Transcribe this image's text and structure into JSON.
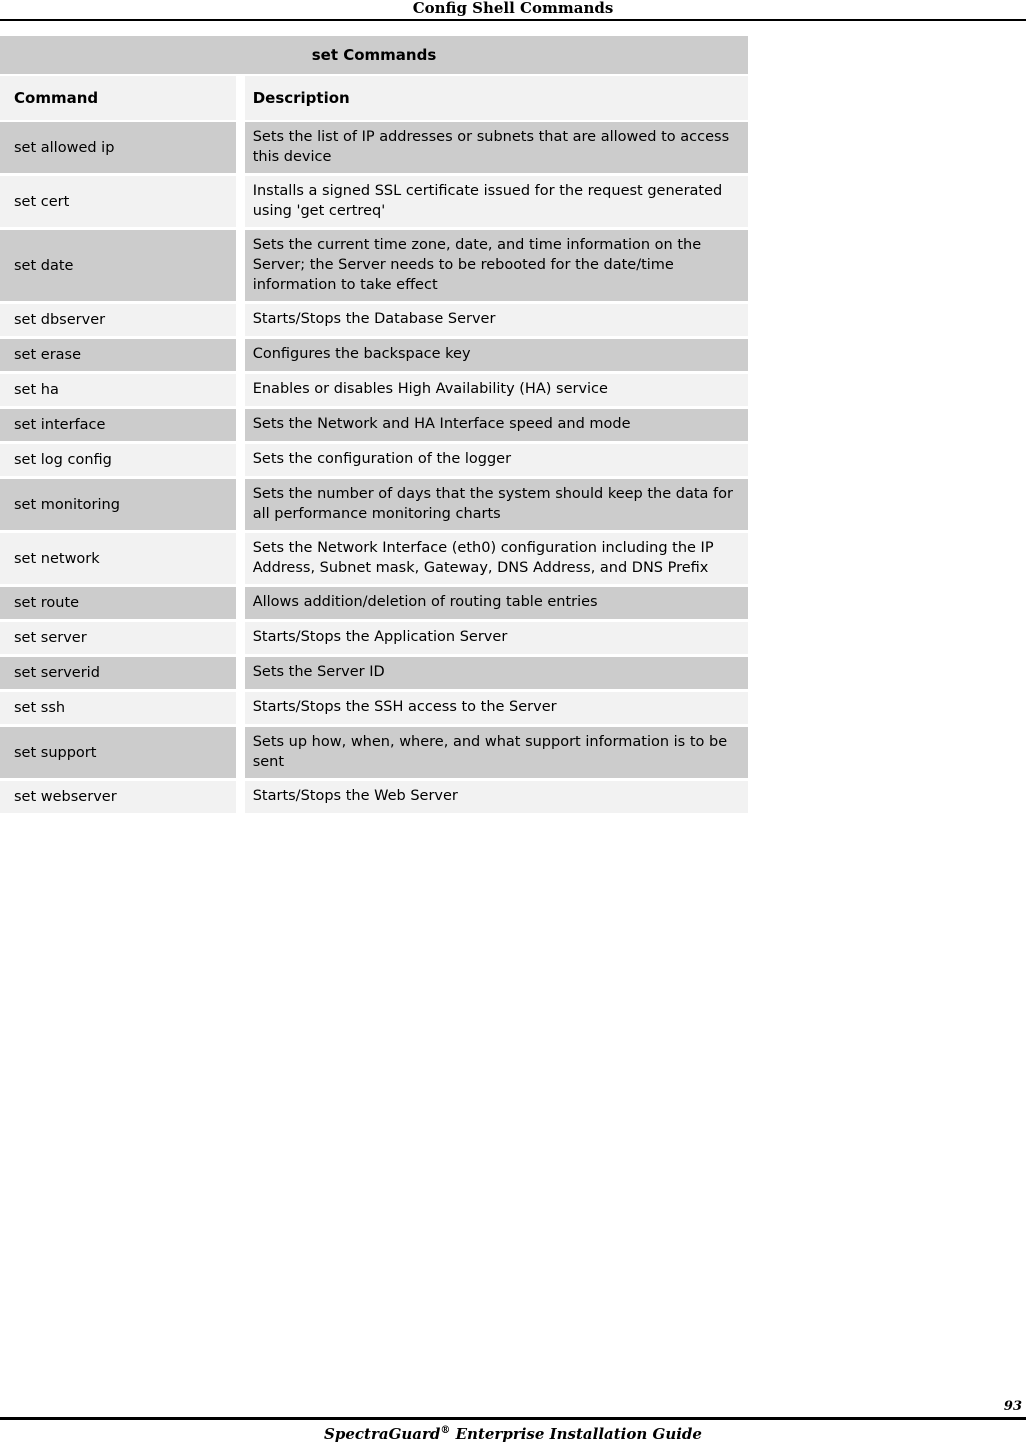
{
  "page": {
    "running_head": "Config Shell Commands",
    "page_number": "93",
    "footer_title_main": "SpectraGuard",
    "footer_title_mark": "®",
    "footer_title_rest": " Enterprise Installation Guide"
  },
  "colors": {
    "shade_row": "#cccccc",
    "light_row": "#f2f2f2",
    "text": "#000000",
    "rule": "#000000",
    "gap": "#ffffff"
  },
  "table": {
    "title": "set Commands",
    "columns": [
      "Command",
      "Description"
    ],
    "rows": [
      {
        "command": "set allowed ip",
        "description": "Sets the list of IP addresses or subnets that are allowed to access this device",
        "shaded": true
      },
      {
        "command": "set cert",
        "description": "Installs a signed SSL certificate issued for the request generated using 'get certreq'",
        "shaded": false
      },
      {
        "command": "set date",
        "description": "Sets the current time zone, date, and time information on the Server; the Server needs to be rebooted for the date/time information to take effect",
        "shaded": true
      },
      {
        "command": "set dbserver",
        "description": "Starts/Stops the Database Server",
        "shaded": false
      },
      {
        "command": "set erase",
        "description": "Configures the backspace key",
        "shaded": true
      },
      {
        "command": "set ha",
        "description": "Enables or disables High Availability (HA) service",
        "shaded": false
      },
      {
        "command": "set interface",
        "description": "Sets the Network and HA Interface speed and mode",
        "shaded": true
      },
      {
        "command": "set log config",
        "description": "Sets the configuration of the logger",
        "shaded": false
      },
      {
        "command": "set monitoring",
        "description": "Sets the number of days that the system should keep the data for all performance monitoring charts",
        "shaded": true
      },
      {
        "command": "set network",
        "description": "Sets the Network Interface (eth0) configuration including the IP Address, Subnet mask, Gateway, DNS Address, and DNS Prefix",
        "shaded": false
      },
      {
        "command": "set route",
        "description": "Allows addition/deletion of routing table entries",
        "shaded": true
      },
      {
        "command": "set server",
        "description": "Starts/Stops the Application Server",
        "shaded": false
      },
      {
        "command": "set serverid",
        "description": "Sets the Server ID",
        "shaded": true
      },
      {
        "command": "set ssh",
        "description": "Starts/Stops the SSH access to the Server",
        "shaded": false
      },
      {
        "command": "set support",
        "description": "Sets up how, when, where, and what support information is to be sent",
        "shaded": true
      },
      {
        "command": "set webserver",
        "description": "Starts/Stops the Web Server",
        "shaded": false
      }
    ]
  }
}
